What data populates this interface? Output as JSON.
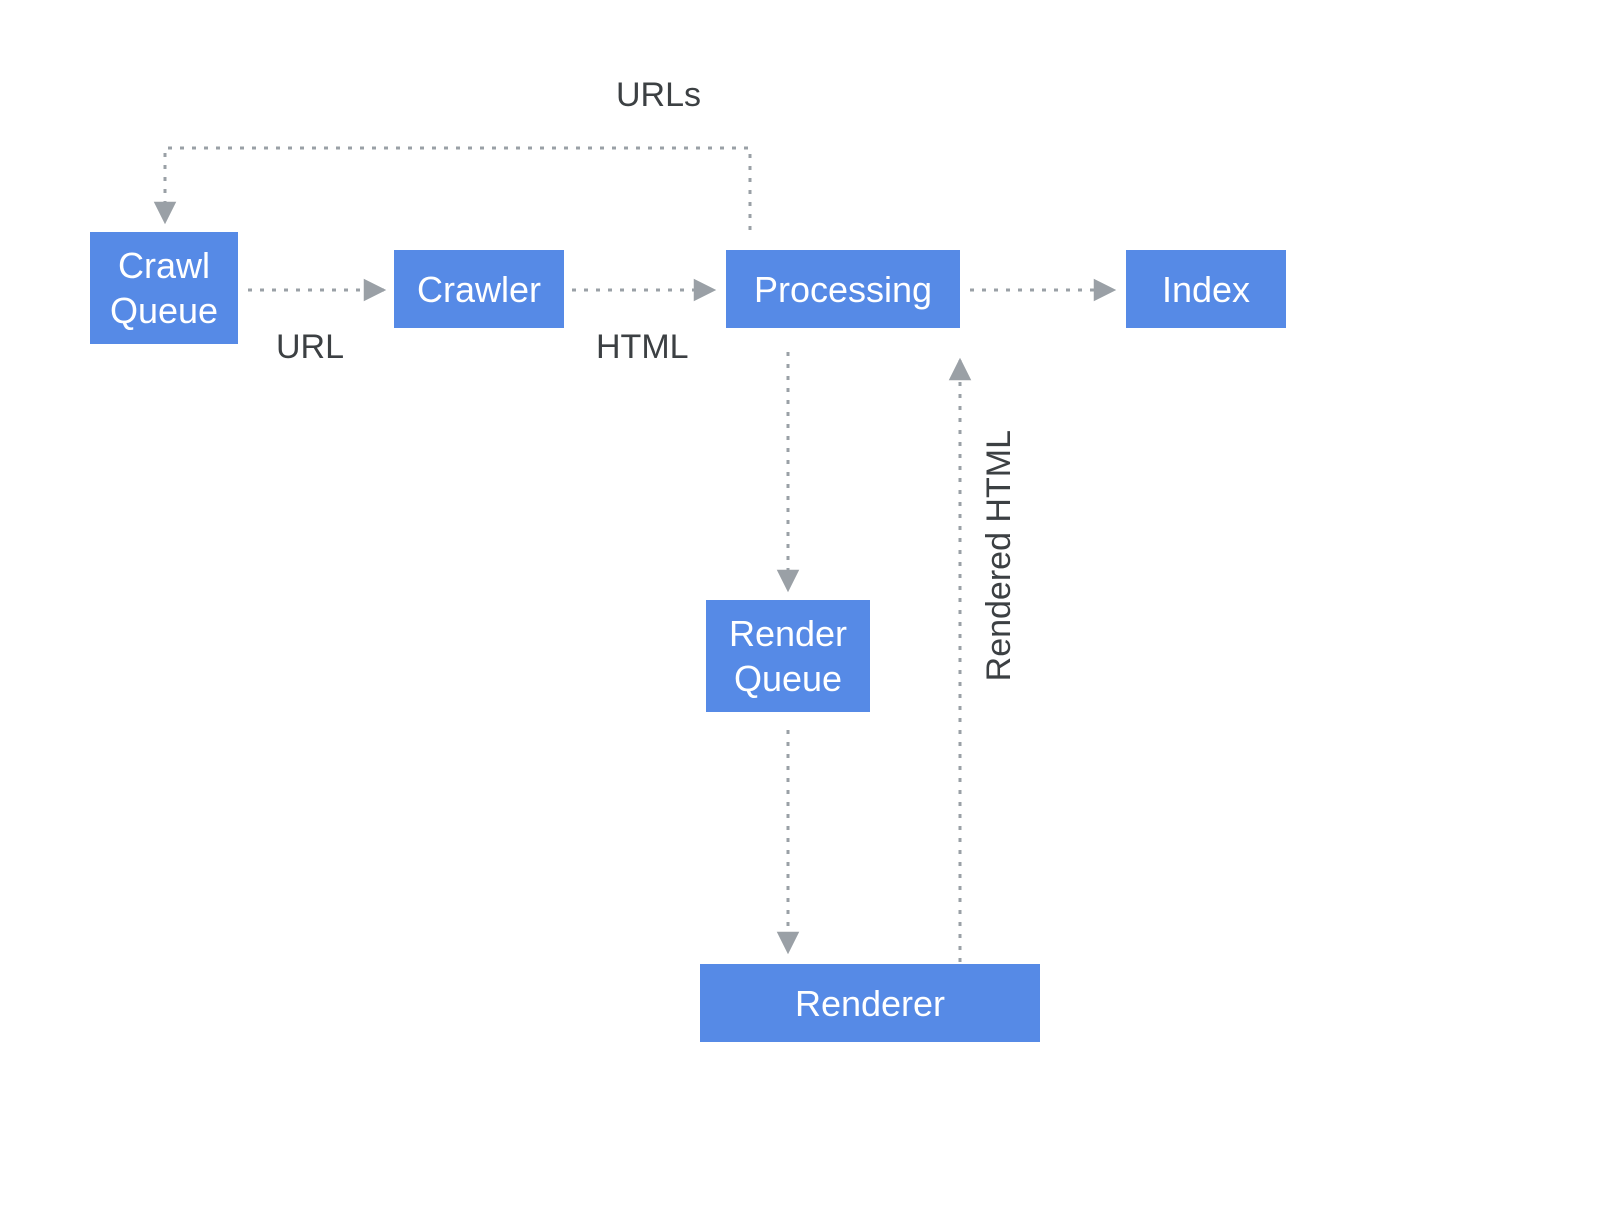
{
  "nodes": {
    "crawl_queue": "Crawl\nQueue",
    "crawler": "Crawler",
    "processing": "Processing",
    "index": "Index",
    "render_queue": "Render\nQueue",
    "renderer": "Renderer"
  },
  "edge_labels": {
    "urls_top": "URLs",
    "url_mid": "URL",
    "html_mid": "HTML",
    "rendered_html": "Rendered HTML"
  },
  "colors": {
    "node_fill": "#568ae6",
    "node_shadow": "#dbe5f7",
    "text_white": "#ffffff",
    "label_dark": "#3c4043",
    "edge_grey": "#9aa0a6"
  }
}
